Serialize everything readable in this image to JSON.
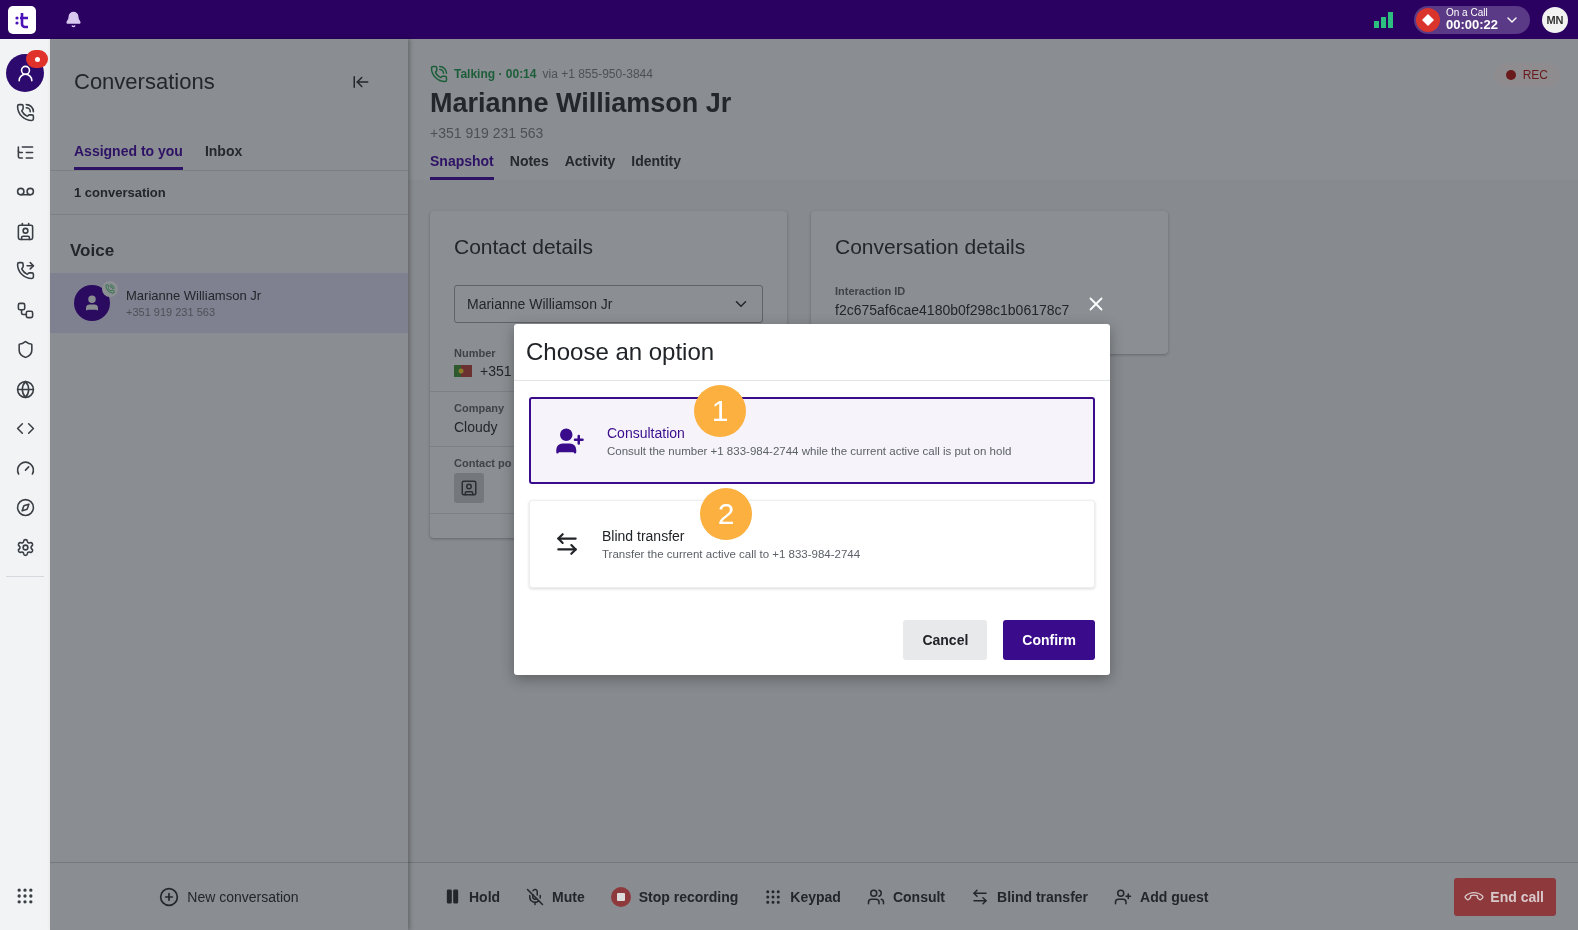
{
  "topbar": {
    "call_status": {
      "label": "On a Call",
      "timer": "00:00:22"
    },
    "avatar": "MN"
  },
  "nav": {
    "items": [
      {
        "selected": true,
        "notification": true
      },
      {
        "selected": false,
        "notification": false
      },
      {
        "selected": false,
        "notification": false
      },
      {
        "selected": false,
        "notification": false
      },
      {
        "selected": false,
        "notification": false
      },
      {
        "selected": false,
        "notification": false
      },
      {
        "selected": false,
        "notification": false
      },
      {
        "selected": false,
        "notification": false
      },
      {
        "selected": false,
        "notification": false
      },
      {
        "selected": false,
        "notification": false
      },
      {
        "selected": false,
        "notification": false
      },
      {
        "selected": false,
        "notification": false
      },
      {
        "selected": false,
        "notification": false
      }
    ]
  },
  "conversations": {
    "title": "Conversations",
    "tabs": [
      {
        "label": "Assigned to you",
        "selected": true
      },
      {
        "label": "Inbox",
        "selected": false
      }
    ],
    "count": "1 conversation",
    "section": "Voice",
    "items": [
      {
        "name": "Marianne Williamson Jr",
        "phone": "+351 919 231 563",
        "selected": true
      }
    ],
    "new_conversation": "New conversation"
  },
  "header": {
    "status": "Talking · 00:14",
    "via": "via +1 855-950-3844",
    "name": "Marianne Williamson Jr",
    "phone": "+351 919 231 563",
    "rec": "REC",
    "tabs": [
      {
        "label": "Snapshot",
        "selected": true
      },
      {
        "label": "Notes",
        "selected": false
      },
      {
        "label": "Activity",
        "selected": false
      },
      {
        "label": "Identity",
        "selected": false
      }
    ]
  },
  "contact_details": {
    "title": "Contact details",
    "select": "Marianne Williamson Jr",
    "fields": [
      {
        "label": "Number",
        "value": "+351",
        "kind": "phone"
      },
      {
        "label": "Company",
        "value": "Cloudy",
        "kind": "text"
      },
      {
        "label": "Contact po",
        "kind": "avatar"
      }
    ]
  },
  "conversation_details": {
    "title": "Conversation details",
    "fields": [
      {
        "label": "Interaction ID",
        "value": "f2c675af6cae4180b0f298c1b06178c7"
      }
    ]
  },
  "dialog": {
    "title": "Choose an option",
    "options": [
      {
        "title": "Consultation",
        "description": "Consult the number +1 833-984-2744 while the current active call is put on hold",
        "selected": true,
        "marker": "1",
        "kind": "consult"
      },
      {
        "title": "Blind transfer",
        "description": "Transfer the current active call to +1 833-984-2744",
        "selected": false,
        "marker": "2",
        "kind": "transfer"
      }
    ],
    "cancel": "Cancel",
    "confirm": "Confirm"
  },
  "call_controls": [
    {
      "label": "Hold",
      "kind": "hold"
    },
    {
      "label": "Mute",
      "kind": "mute"
    },
    {
      "label": "Stop recording",
      "kind": "record"
    },
    {
      "label": "Keypad",
      "kind": "keypad"
    },
    {
      "label": "Consult",
      "kind": "consult"
    },
    {
      "label": "Blind transfer",
      "kind": "transfer"
    },
    {
      "label": "Add guest",
      "kind": "guest"
    }
  ],
  "end_call": "End call"
}
